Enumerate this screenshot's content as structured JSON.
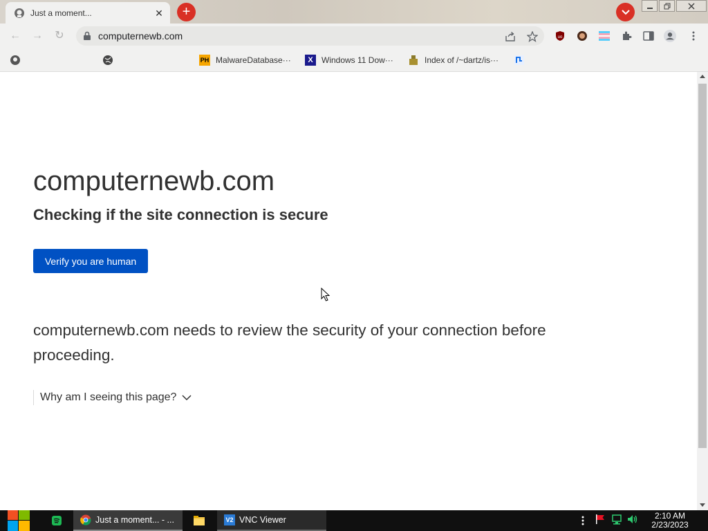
{
  "browser": {
    "tab": {
      "title": "Just a moment...",
      "close_glyph": "✕",
      "favicon": "page-favicon-icon"
    },
    "new_tab_glyph": "+",
    "tab_search_icon": "chevron-down-icon",
    "window_controls": [
      "minimize-icon",
      "restore-icon",
      "close-icon"
    ],
    "nav": {
      "back_glyph": "←",
      "forward_glyph": "→",
      "reload_glyph": "↻"
    },
    "address_bar": {
      "url": "computernewb.com",
      "secure_icon": "lock-icon",
      "actions": [
        "share-icon",
        "bookmark-star-icon"
      ]
    },
    "extensions": [
      "ublock-origin-icon",
      "profile-extension-icon",
      "flag-extension-icon",
      "puzzle-extensions-icon",
      "side-panel-icon",
      "profile-avatar-icon",
      "menu-kebab-icon"
    ],
    "bookmarks": [
      {
        "label": "",
        "icon": "bookmark-icon"
      },
      {
        "label": "",
        "icon": "globe-icon"
      },
      {
        "label": "MalwareDatabase···",
        "icon": "ph-icon",
        "icon_text": "PH"
      },
      {
        "label": "Windows 11 Dow···",
        "icon": "x-icon",
        "icon_text": "X"
      },
      {
        "label": "Index of /~dartz/is···",
        "icon": "folder-index-icon"
      },
      {
        "label": "",
        "icon": "bookmark-app-icon"
      }
    ]
  },
  "page": {
    "site": "computernewb.com",
    "heading": "Checking if the site connection is secure",
    "verify_button": "Verify you are human",
    "message": "computernewb.com needs to review the security of your connection before proceeding.",
    "why_link": "Why am I seeing this page?"
  },
  "taskbar": {
    "items": [
      {
        "label": "Just a moment... - ...",
        "icon": "chrome-icon"
      },
      {
        "label": "VNC Viewer",
        "icon": "vnc-icon",
        "icon_text": "V2"
      }
    ],
    "pinned": [
      "spotify-icon",
      "file-explorer-icon"
    ],
    "tray": [
      "overflow-dots-icon",
      "action-center-flag-icon",
      "network-icon",
      "volume-icon"
    ],
    "clock": {
      "time": "2:10 AM",
      "date": "2/23/2023"
    }
  },
  "colors": {
    "accent": "#0051c3",
    "tab_button_red": "#d93025",
    "text": "#313131"
  }
}
